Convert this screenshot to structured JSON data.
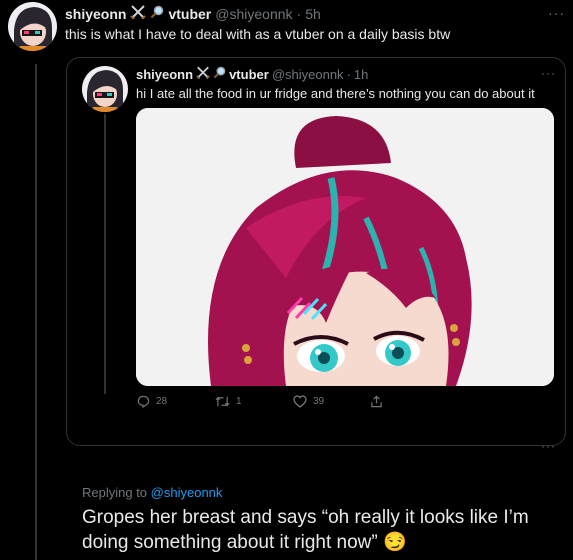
{
  "main_tweet": {
    "display_name": "shiyeonn",
    "name_suffix": "vtuber",
    "handle": "@shiyeonnk",
    "time": "5h",
    "text": "this is what I have to deal with as a vtuber on a daily basis btw"
  },
  "quoted_tweet": {
    "display_name": "shiyeonn",
    "name_suffix": "vtuber",
    "handle": "@shiyeonnk",
    "time": "1h",
    "text": "hi I ate all the food in ur fridge and there’s nothing you can do about it",
    "actions": {
      "replies": "28",
      "retweets": "1",
      "likes": "39"
    }
  },
  "reply": {
    "replying_to_label": "Replying to",
    "replying_to_handle": "@shiyeonnk",
    "text": "Gropes her breast and says “oh really it looks like I’m doing something about it right now”",
    "emoji": "😏"
  },
  "colors": {
    "background": "#000000",
    "text": "#e7e9ea",
    "muted": "#71767b",
    "link": "#1d9bf0",
    "hair": "#a3124f",
    "eyes": "#33c9c9",
    "hair_streak": "#2bb3b0"
  },
  "icons": [
    "crossed-swords-icon",
    "magnifier-icon",
    "more-dots-icon",
    "reply-icon",
    "retweet-icon",
    "like-icon",
    "share-icon"
  ]
}
